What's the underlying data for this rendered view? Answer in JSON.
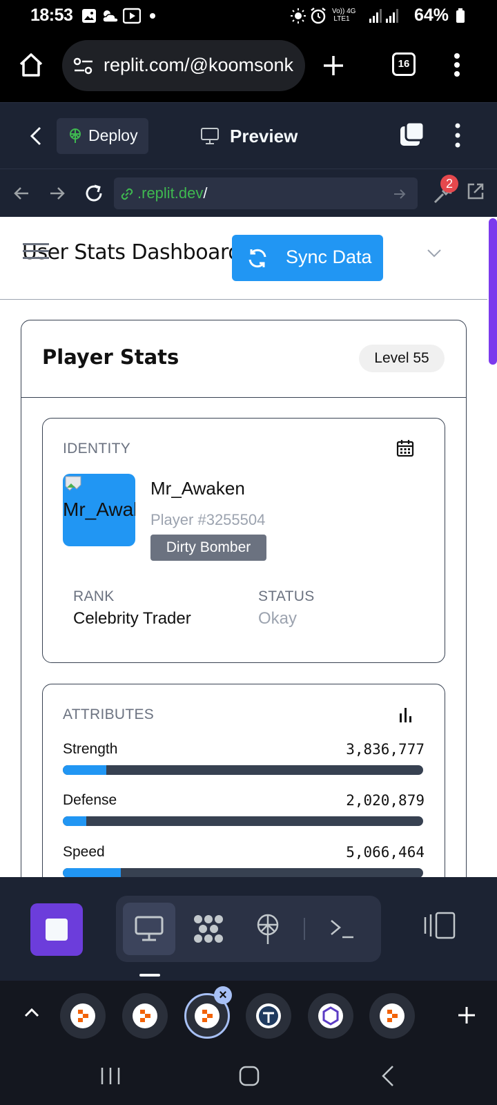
{
  "status_bar": {
    "time": "18:53",
    "network_top": "Vo)) 4G",
    "network_bottom": "LTE1",
    "battery": "64%"
  },
  "browser": {
    "url": "replit.com/@koomsonk",
    "tab_count": "16"
  },
  "replit_header": {
    "deploy_label": "Deploy",
    "preview_label": "Preview"
  },
  "webview": {
    "url_domain": ".replit.dev",
    "url_path": "/",
    "devtools_badge": "2"
  },
  "page": {
    "title": "User Stats Dashboard",
    "sync_button": "Sync Data",
    "card_title": "Player Stats",
    "level_badge": "Level 55",
    "identity": {
      "section_label": "IDENTITY",
      "avatar_alt": "Mr_Awaken",
      "name": "Mr_Awaken",
      "player_id": "Player #3255504",
      "role_badge": "Dirty Bomber",
      "rank_label": "RANK",
      "rank_value": "Celebrity Trader",
      "status_label": "STATUS",
      "status_value": "Okay"
    },
    "attributes": {
      "section_label": "ATTRIBUTES",
      "items": [
        {
          "name": "Strength",
          "value": "3,836,777",
          "fill_fraction": 0.12
        },
        {
          "name": "Defense",
          "value": "2,020,879",
          "fill_fraction": 0.065
        },
        {
          "name": "Speed",
          "value": "5,066,464",
          "fill_fraction": 0.16
        }
      ]
    }
  },
  "colors": {
    "accent": "#2196f3",
    "replit_bg": "#1c2333",
    "ide_home": "#6c3ddb"
  }
}
